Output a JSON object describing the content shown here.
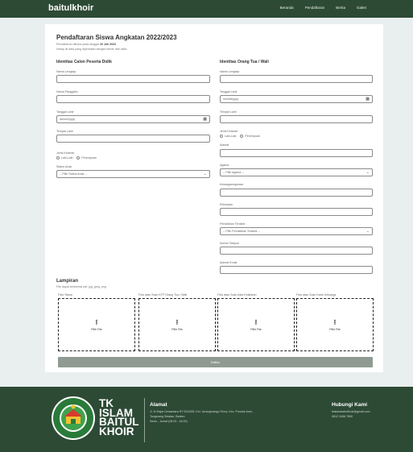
{
  "nav": {
    "brand": "baitulkhoir",
    "links": [
      "Beranda",
      "Pendaftaran",
      "Berita",
      "Galeri"
    ]
  },
  "page": {
    "title": "Pendaftaran Siswa Angkatan 2022/2023",
    "subtitle_prefix": "Pendaftaran dibuka pada tanggal ",
    "subtitle_date": "20 Juli 2022",
    "subtitle2": "Harap isi data yang diperlukan dengan benar dan valid."
  },
  "student": {
    "section_title": "Identitas Calon Peserta Didik",
    "name_label": "Nama Lengkap",
    "nickname_label": "Nama Panggilan",
    "birthdate_label": "Tanggal Lahir",
    "birthdate_placeholder": "dd/mm/yyyy",
    "birthplace_label": "Tempat Lahir",
    "gender_label": "Jenis Kelamin",
    "gender_options": [
      "Laki-Laki",
      "Perempuan"
    ],
    "status_label": "Status Anak",
    "status_placeholder": "-- Pilih Status Anak --"
  },
  "parent": {
    "section_title": "Identitas Orang Tua / Wali",
    "name_label": "Nama Lengkap",
    "birthdate_label": "Tanggal Lahir",
    "birthdate_placeholder": "mm/dd/yyyy",
    "birthplace_label": "Tempat Lahir",
    "gender_label": "Jenis Kelamin",
    "gender_options": [
      "Laki-Laki",
      "Perempuan"
    ],
    "address_label": "Alamat",
    "religion_label": "Agama",
    "religion_placeholder": "-- Pilih Agama --",
    "nationality_label": "Kewarganegaraan",
    "job_label": "Pekerjaan",
    "education_label": "Pendidikan Terakhir",
    "education_placeholder": "-- Pilih Pendidikan Terakhir --",
    "phone_label": "Nomor Telepon",
    "email_label": "Alamat Email"
  },
  "attachments": {
    "title": "Lampiran",
    "subtitle": "File dapat berformat pdf, jpg, jpeg, png",
    "items": [
      {
        "label": "Foto Siswa",
        "button": "Pilih File"
      },
      {
        "label": "Foto atau Scan KTP Orang Tua / Wali",
        "button": "Pilih File"
      },
      {
        "label": "Foto atau Scan Akta Kelahiran",
        "button": "Pilih File"
      },
      {
        "label": "Foto atau Scan Kartu Keluarga",
        "button": "Pilih File"
      }
    ]
  },
  "submit_label": "Daftar",
  "footer": {
    "school_lines": [
      "TK",
      "ISLAM",
      "BAITUL",
      "KHOIR"
    ],
    "address_title": "Alamat",
    "address_lines": [
      "Jl. Ki Hajar Dewantara RT 001/005, Kel. Jurangmangu Timur, Kec. Pondok Aren,",
      "Tangerang Selatan, Banten",
      "Senin - Jumat (08.00 - 16.00)"
    ],
    "contact_title": "Hubungi Kami",
    "contact_lines": [
      "tkislambaitulkhoir@gmail.com",
      "0812 3456 7890"
    ]
  },
  "colors": {
    "primary": "#2d4a35",
    "background": "#e9eeee",
    "button_disabled": "#8e9a92"
  }
}
